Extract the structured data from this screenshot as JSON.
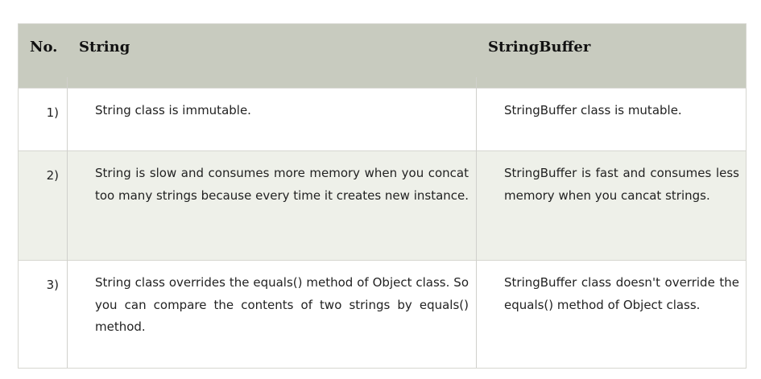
{
  "table": {
    "headers": [
      "No.",
      "String",
      "StringBuffer"
    ],
    "rows": [
      {
        "no": "1)",
        "string": "String class is immutable.",
        "stringbuffer": "StringBuffer class is mutable."
      },
      {
        "no": "2)",
        "string": "String is slow and consumes more memory when you concat too many strings because every time it creates new instance.",
        "stringbuffer": "StringBuffer is fast and consumes less memory when you cancat strings."
      },
      {
        "no": "3)",
        "string": "String class overrides the equals() method of Object class. So you can compare the contents of two strings by equals() method.",
        "stringbuffer": "StringBuffer class doesn't override the equals() method of Object class."
      }
    ]
  }
}
